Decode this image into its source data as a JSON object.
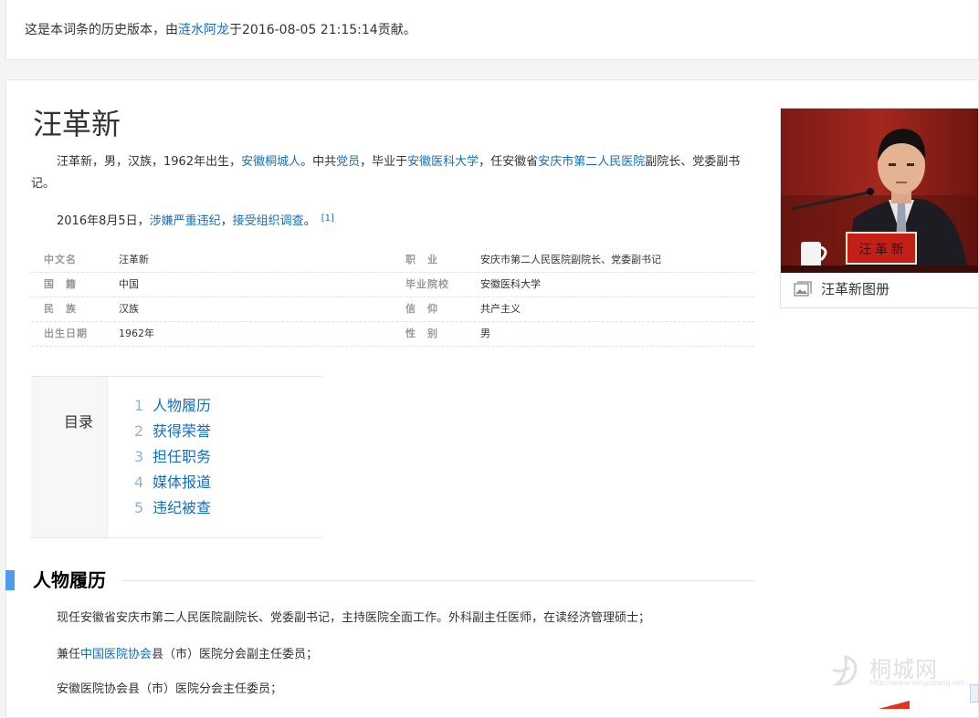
{
  "history": {
    "prefix": "这是本词条的历史版本，由",
    "author": "涟水阿龙",
    "suffix": "于2016-08-05 21:15:14贡献。"
  },
  "lemma": {
    "title": "汪革新",
    "summary": {
      "p1_a": "汪革新，男，汉族，1962年出生，",
      "p1_link1": "安徽桐城人",
      "p1_b": "。中共",
      "p1_link2": "党员",
      "p1_c": "，毕业于",
      "p1_link3": "安徽医科大学",
      "p1_d": "，任安徽省",
      "p1_link4": "安庆市第二人民医院",
      "p1_e": "副院长、党委副书记。",
      "p2_a": "2016年8月5日，",
      "p2_link1": "涉嫌严重违纪",
      "p2_b": "，",
      "p2_link2": "接受组织调查",
      "p2_c": "。",
      "p2_ref": "[1]"
    }
  },
  "infobox": {
    "rows": [
      {
        "left_key": "中文名",
        "left_val": "汪革新",
        "right_key": "职　业",
        "right_val": "安庆市第二人民医院副院长、党委副书记"
      },
      {
        "left_key": "国　籍",
        "left_val": "中国",
        "right_key": "毕业院校",
        "right_val": "安徽医科大学"
      },
      {
        "left_key": "民　族",
        "left_val": "汉族",
        "right_key": "信　仰",
        "right_val": "共产主义"
      },
      {
        "left_key": "出生日期",
        "left_val": "1962年",
        "right_key": "性　别",
        "right_val": "男"
      }
    ]
  },
  "catalog": {
    "title": "目录",
    "items": [
      {
        "num": "1",
        "label": "人物履历"
      },
      {
        "num": "2",
        "label": "获得荣誉"
      },
      {
        "num": "3",
        "label": "担任职务"
      },
      {
        "num": "4",
        "label": "媒体报道"
      },
      {
        "num": "5",
        "label": "违纪被查"
      }
    ]
  },
  "section": {
    "title": "人物履历",
    "p1": "现任安徽省安庆市第二人民医院副院长、党委副书记，主持医院全面工作。外科副主任医师，在读经济管理硕士；",
    "p2_a": "兼任",
    "p2_link": "中国医院协会",
    "p2_b": "县（市）医院分会副主任委员；",
    "p3": "安徽医院协会县（市）医院分会主任委员；"
  },
  "album": {
    "caption": "汪革新图册",
    "nameplate": "汪 革 新"
  },
  "watermark": {
    "text": "桐城网",
    "url": "http://www.tongcheng.net"
  },
  "colors": {
    "link": "#136ec2",
    "accent": "#4f9cee"
  }
}
